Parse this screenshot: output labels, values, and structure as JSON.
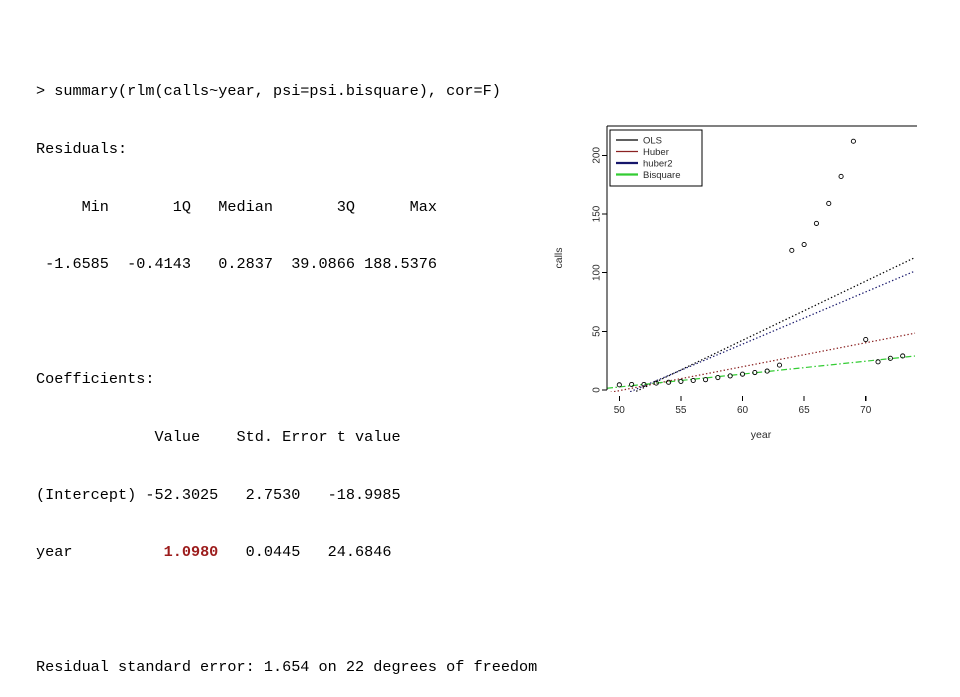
{
  "console": {
    "lines": [
      {
        "id": "prompt-line",
        "text": "> summary(rlm(calls~year, psi=psi.bisquare), cor=F)"
      },
      {
        "id": "residuals-header",
        "text": "Residuals:"
      },
      {
        "id": "residuals-colnames",
        "text": "     Min       1Q   Median       3Q      Max"
      },
      {
        "id": "residuals-values",
        "text": " -1.6585  -0.4143   0.2837  39.0866 188.5376"
      },
      {
        "id": "blank-1",
        "text": ""
      },
      {
        "id": "coefficients-header",
        "text": "Coefficients:"
      },
      {
        "id": "coefficients-colnames",
        "text": "             Value    Std. Error t value"
      },
      {
        "id": "coefficients-row-intercept",
        "text": "(Intercept) -52.3025   2.7530   -18.9985"
      }
    ],
    "coefficients_row_year": {
      "prefix": "year          ",
      "value": "1.0980",
      "suffix": "   0.0445   24.6846"
    },
    "blank_after_coefficients": "",
    "residual_standard_error": "Residual standard error: 1.654 on 22 degrees of freedom",
    "highlight_color": "#9C1C1C"
  },
  "chart_data": {
    "type": "scatter",
    "title": "",
    "xlabel": "year",
    "ylabel": "calls",
    "xlim": [
      49,
      74
    ],
    "ylim": [
      0,
      225
    ],
    "xticks": [
      50,
      55,
      60,
      65,
      70
    ],
    "yticks": [
      0,
      50,
      100,
      150,
      200
    ],
    "xtick_labels": [
      "50",
      "55",
      "60",
      "65",
      "70"
    ],
    "ytick_labels": [
      "0",
      "50",
      "100",
      "150",
      "200"
    ],
    "grid": false,
    "legend_position": "top-left",
    "points": [
      {
        "x": 50,
        "y": 4.4
      },
      {
        "x": 51,
        "y": 4.7
      },
      {
        "x": 52,
        "y": 4.7
      },
      {
        "x": 53,
        "y": 5.9
      },
      {
        "x": 54,
        "y": 6.6
      },
      {
        "x": 55,
        "y": 7.3
      },
      {
        "x": 56,
        "y": 8.1
      },
      {
        "x": 57,
        "y": 8.8
      },
      {
        "x": 58,
        "y": 10.6
      },
      {
        "x": 59,
        "y": 12.0
      },
      {
        "x": 60,
        "y": 13.5
      },
      {
        "x": 61,
        "y": 14.9
      },
      {
        "x": 62,
        "y": 16.1
      },
      {
        "x": 63,
        "y": 21.2
      },
      {
        "x": 64,
        "y": 119.0
      },
      {
        "x": 65,
        "y": 124.0
      },
      {
        "x": 66,
        "y": 142.0
      },
      {
        "x": 67,
        "y": 159.0
      },
      {
        "x": 68,
        "y": 182.0
      },
      {
        "x": 69,
        "y": 212.0
      },
      {
        "x": 70,
        "y": 43.0
      },
      {
        "x": 71,
        "y": 24.0
      },
      {
        "x": 72,
        "y": 27.0
      },
      {
        "x": 73,
        "y": 29.0
      }
    ],
    "series": [
      {
        "name": "OLS",
        "color": "#000000",
        "style": "dotted",
        "intercept": -260.1,
        "slope": 5.041
      },
      {
        "name": "Huber",
        "color": "#8B2222",
        "style": "dotted",
        "intercept": -102.6,
        "slope": 2.041
      },
      {
        "name": "huber2",
        "color": "#16166B",
        "style": "dotted",
        "intercept": -227.9,
        "slope": 4.45
      },
      {
        "name": "Bisquare",
        "color": "#33CC33",
        "style": "dashdot",
        "intercept": -52.3025,
        "slope": 1.098
      }
    ],
    "legend": [
      {
        "label": "OLS",
        "color": "#000000"
      },
      {
        "label": "Huber",
        "color": "#8B2222"
      },
      {
        "label": "huber2",
        "color": "#16166B"
      },
      {
        "label": "Bisquare",
        "color": "#33CC33"
      }
    ]
  }
}
